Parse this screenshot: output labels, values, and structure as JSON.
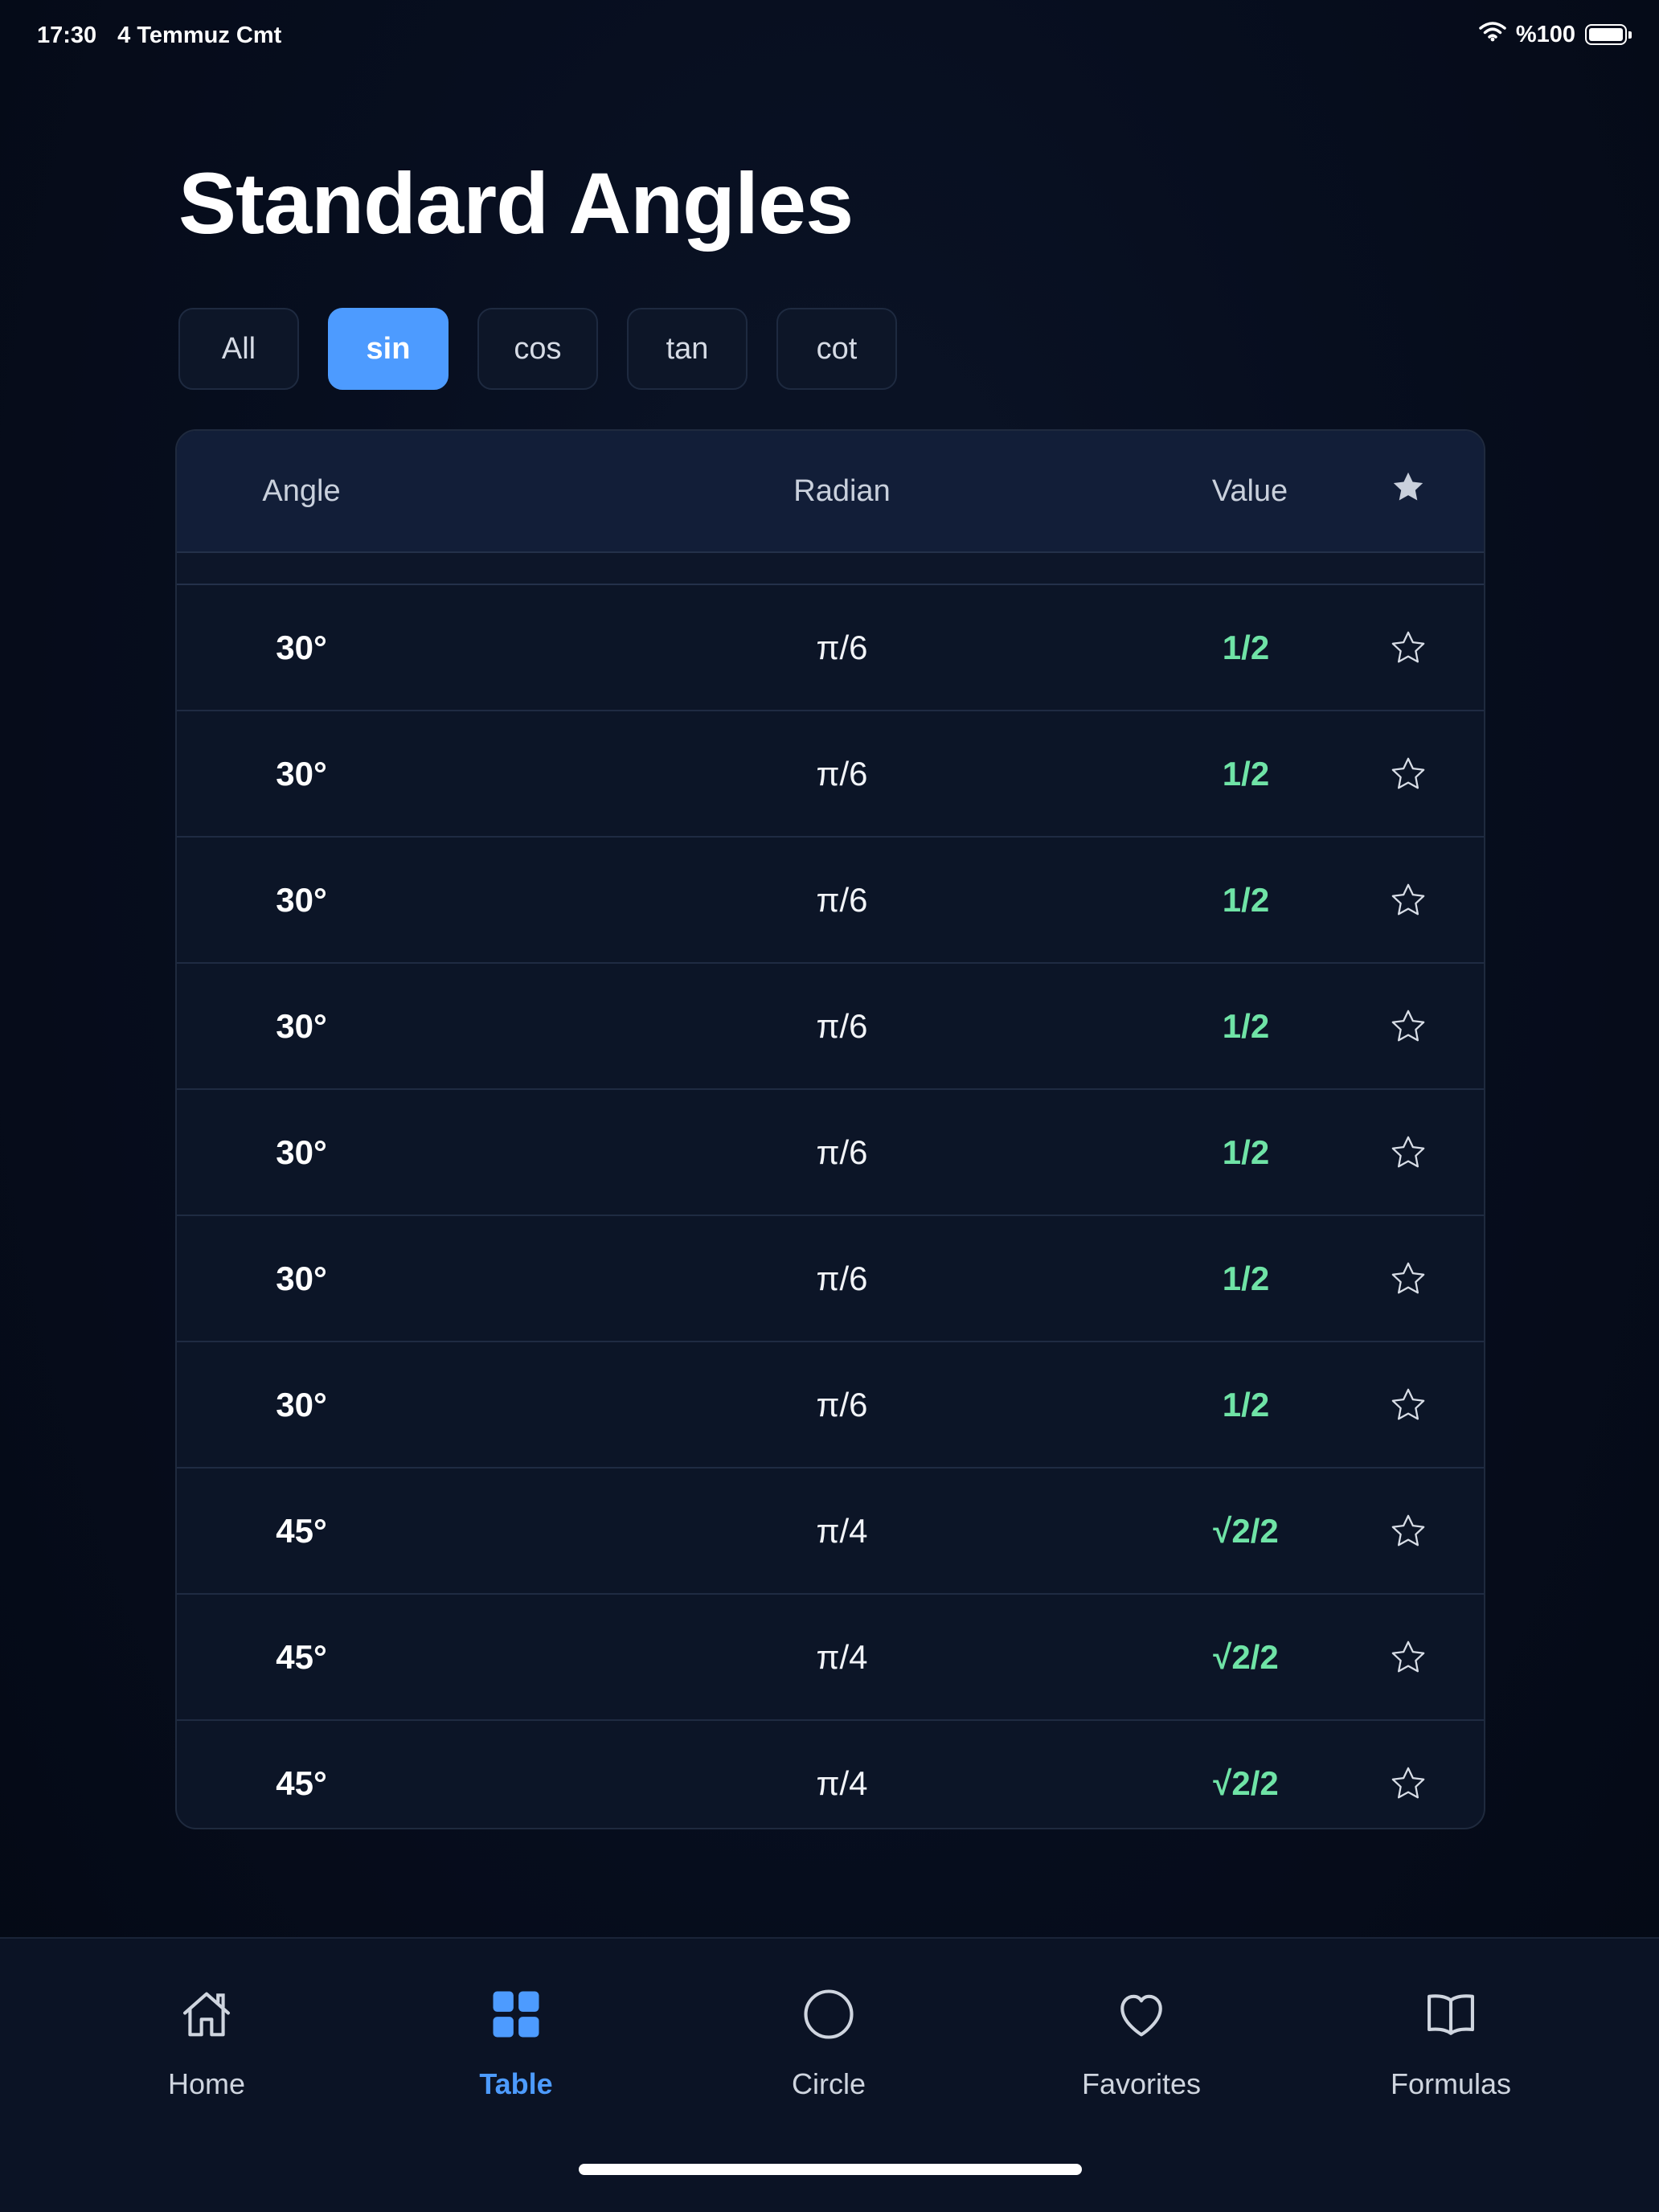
{
  "status_bar": {
    "time": "17:30",
    "date": "4 Temmuz Cmt",
    "battery": "%100",
    "battery_level": 1.0
  },
  "page": {
    "title": "Standard Angles"
  },
  "filters": [
    {
      "label": "All",
      "active": false
    },
    {
      "label": "sin",
      "active": true
    },
    {
      "label": "cos",
      "active": false
    },
    {
      "label": "tan",
      "active": false
    },
    {
      "label": "cot",
      "active": false
    }
  ],
  "table": {
    "headers": {
      "angle": "Angle",
      "radian": "Radian",
      "value": "Value",
      "favorite_icon": "star-filled-icon"
    },
    "rows": [
      {
        "angle": "30°",
        "radian": "π/6",
        "value": "1/2",
        "favorite": false
      },
      {
        "angle": "30°",
        "radian": "π/6",
        "value": "1/2",
        "favorite": false
      },
      {
        "angle": "30°",
        "radian": "π/6",
        "value": "1/2",
        "favorite": false
      },
      {
        "angle": "30°",
        "radian": "π/6",
        "value": "1/2",
        "favorite": false
      },
      {
        "angle": "30°",
        "radian": "π/6",
        "value": "1/2",
        "favorite": false
      },
      {
        "angle": "30°",
        "radian": "π/6",
        "value": "1/2",
        "favorite": false
      },
      {
        "angle": "30°",
        "radian": "π/6",
        "value": "1/2",
        "favorite": false
      },
      {
        "angle": "45°",
        "radian": "π/4",
        "value": "√2/2",
        "favorite": false
      },
      {
        "angle": "45°",
        "radian": "π/4",
        "value": "√2/2",
        "favorite": false
      },
      {
        "angle": "45°",
        "radian": "π/4",
        "value": "√2/2",
        "favorite": false
      }
    ]
  },
  "bottom_nav": [
    {
      "label": "Home",
      "icon": "home-icon",
      "active": false
    },
    {
      "label": "Table",
      "icon": "grid-icon",
      "active": true
    },
    {
      "label": "Circle",
      "icon": "circle-icon",
      "active": false
    },
    {
      "label": "Favorites",
      "icon": "heart-icon",
      "active": false
    },
    {
      "label": "Formulas",
      "icon": "book-icon",
      "active": false
    }
  ],
  "colors": {
    "accent": "#4d9bff",
    "value_green": "#6fe3a6",
    "background": "#050b1a"
  }
}
